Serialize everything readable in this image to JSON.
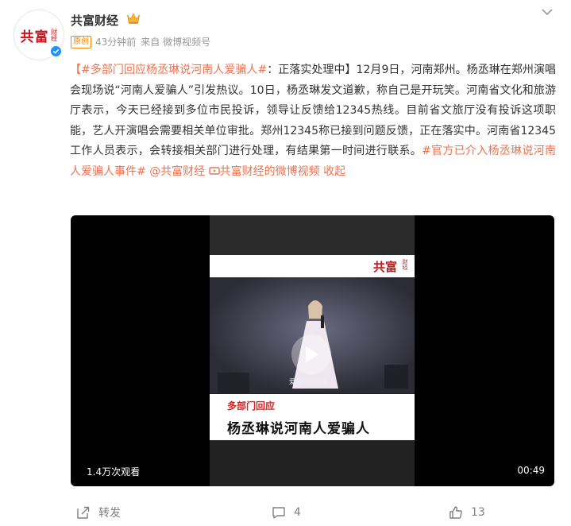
{
  "account": {
    "name": "共富财经",
    "avatar_text": "共富",
    "avatar_sub": "财经",
    "crown_icon": "crown-icon",
    "verified_icon": "verified-icon"
  },
  "meta": {
    "badge": "原创",
    "time": "43分钟前",
    "source": "来自 微博视频号"
  },
  "post": {
    "hashtag1": "【#多部门回应杨丞琳说河南人爱骗人#",
    "text1": "：正落实处理中】12月9日，河南郑州。杨丞琳在郑州演唱会现场说“河南人爱骗人”引发热议。10日，杨丞琳发文道歉，称自己是开玩笑。河南省文化和旅游厅表示，今天已经接到多位市民投诉，领导让反馈给12345热线。目前省文旅厅没有投诉这项职能，艺人开演唱会需要相关单位审批。郑州12345称已接到问题反馈，正在落实中。河南省12345工作人员表示，会转接相关部门进行处理，有结果第一时间进行联系。",
    "hashtag2": "#官方已介入杨丞琳说河南人爱骗人事件#",
    "mention": "@共富财经",
    "video_link": "共富财经的微博视频",
    "collapse": "收起"
  },
  "video": {
    "brand": "共富",
    "brand_sub": "财经",
    "subtitle": "爱骗人的事情",
    "banner_red": "多部门回应",
    "banner_title": "杨丞琳说河南人爱骗人",
    "views": "1.4万次观看",
    "duration": "00:49"
  },
  "actions": {
    "repost": "转发",
    "comments": "4",
    "likes": "13"
  },
  "colors": {
    "accent": "#eb7350",
    "badge": "#ff8200",
    "verified": "#1e90ff"
  }
}
